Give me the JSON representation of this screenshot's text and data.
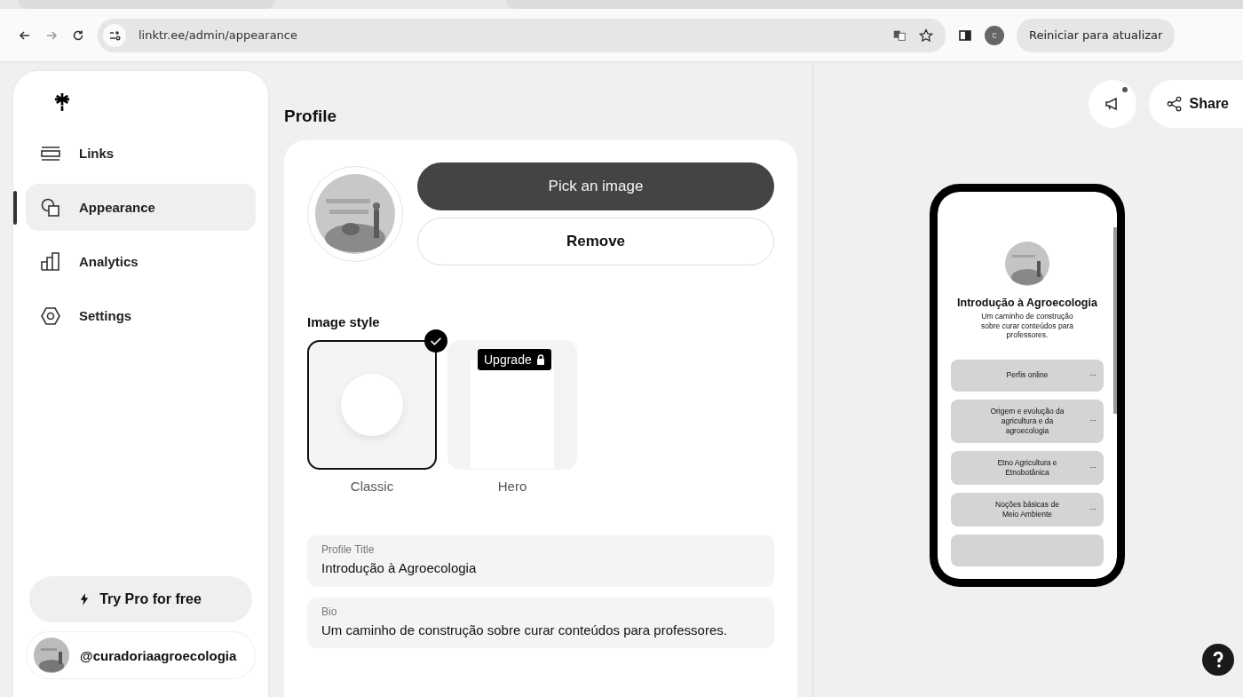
{
  "browser": {
    "url": "linktr.ee/admin/appearance",
    "profile_letter": "c",
    "restart_button": "Reiniciar para atualizar"
  },
  "sidebar": {
    "items": [
      {
        "label": "Links",
        "kind": "links",
        "selected": false
      },
      {
        "label": "Appearance",
        "kind": "appearance",
        "selected": true
      },
      {
        "label": "Analytics",
        "kind": "analytics",
        "selected": false
      },
      {
        "label": "Settings",
        "kind": "settings",
        "selected": false
      }
    ],
    "pro_button": "Try Pro for free",
    "account": "@curadoriaagroecologia"
  },
  "profile": {
    "heading": "Profile",
    "pick_button": "Pick an image",
    "remove_button": "Remove",
    "image_style": {
      "label": "Image style",
      "options": [
        {
          "label": "Classic",
          "kind": "classic",
          "selected": true,
          "locked": false
        },
        {
          "label": "Hero",
          "kind": "hero",
          "selected": false,
          "locked": true,
          "badge": "Upgrade"
        }
      ]
    },
    "fields": [
      {
        "label": "Profile Title",
        "value": "Introdução à Agroecologia"
      },
      {
        "label": "Bio",
        "value": "Um caminho de construção sobre curar conteúdos para professores."
      }
    ]
  },
  "preview": {
    "share_button": "Share",
    "title": "Introdução à Agroecologia",
    "bio": "Um caminho de construção sobre curar conteúdos para professores.",
    "links": [
      {
        "label": "Perfis online",
        "menu": "···"
      },
      {
        "label": "Origem e evolução da agricultura e da agroecologia",
        "menu": "···"
      },
      {
        "label": "Etno Agricultura e Etnobotânica",
        "menu": "···"
      },
      {
        "label": "Noções básicas de Meio Ambiente",
        "menu": "···"
      }
    ]
  }
}
